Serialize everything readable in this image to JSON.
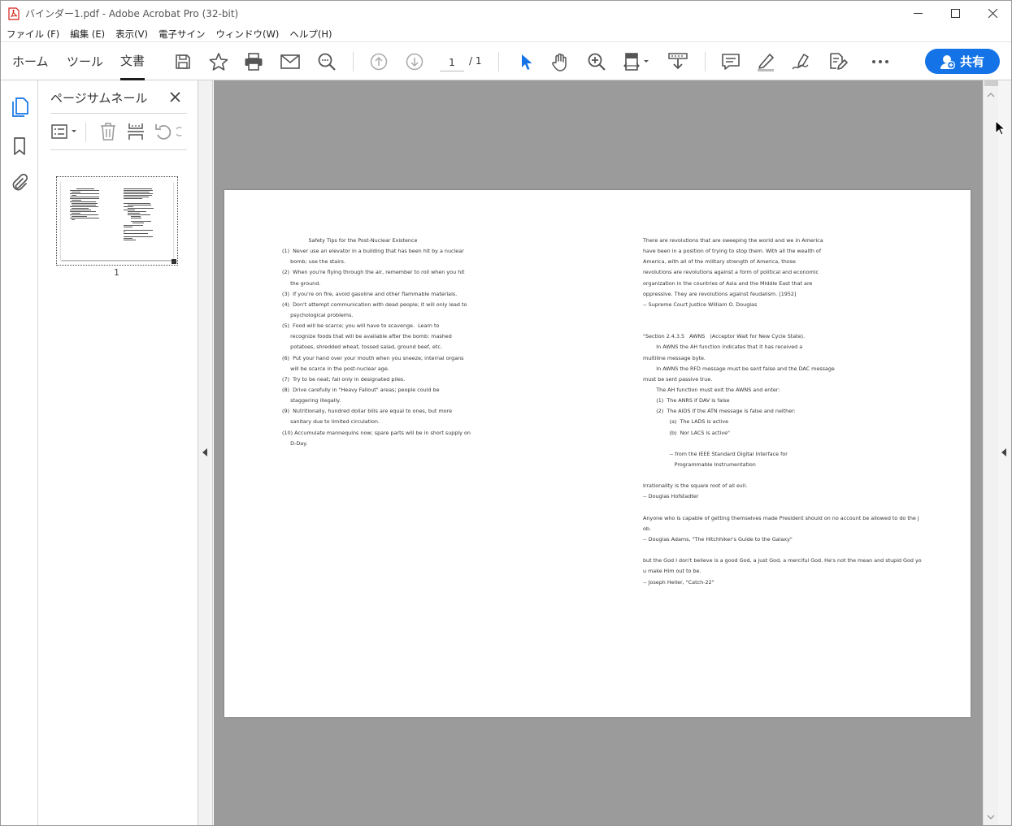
{
  "window": {
    "title": "バインダー1.pdf - Adobe Acrobat Pro (32-bit)"
  },
  "menu": [
    "ファイル (F)",
    "編集 (E)",
    "表示(V)",
    "電子サイン",
    "ウィンドウ(W)",
    "ヘルプ(H)"
  ],
  "tabs": {
    "home": "ホーム",
    "tools": "ツール",
    "document": "文書"
  },
  "toolbar": {
    "page_current": "1",
    "page_total": "/ 1",
    "share_label": "共有"
  },
  "icons": {
    "save": "save-icon",
    "bookmark": "star-icon",
    "print": "print-icon",
    "email": "email-icon",
    "find": "search-icon",
    "prev": "arrow-up-icon",
    "next": "arrow-down-icon",
    "select": "cursor-icon",
    "hand": "hand-icon",
    "zoom": "zoom-in-icon",
    "fit": "fit-page-icon",
    "scroll": "scroll-mode-icon",
    "comment": "comment-icon",
    "highlight": "highlight-icon",
    "sign": "sign-icon",
    "edit": "edit-pdf-icon",
    "more": "more-icon"
  },
  "colors": {
    "accent": "#1473e6",
    "doc_bg": "#9b9b9b"
  },
  "panel": {
    "title": "ページサムネール",
    "thumb_label": "1"
  },
  "page": {
    "left_column": [
      "                Safety Tips for the Post-Nuclear Existence",
      "(1)  Never use an elevator in a building that has been hit by a nuclear",
      "     bomb; use the stairs.",
      "(2)  When you're flying through the air, remember to roll when you hit",
      "     the ground.",
      "(3)  If you're on fire, avoid gasoline and other flammable materials.",
      "(4)  Don't attempt communication with dead people; it will only lead to",
      "     psychological problems.",
      "(5)  Food will be scarce; you will have to scavenge.  Learn to",
      "     recognize foods that will be available after the bomb: mashed",
      "     potatoes, shredded wheat, tossed salad, ground beef, etc.",
      "(6)  Put your hand over your mouth when you sneeze; internal organs",
      "     will be scarce in the post-nuclear age.",
      "(7)  Try to be neat; fall only in designated piles.",
      "(8)  Drive carefully in \"Heavy Fallout\" areas; people could be",
      "     staggering illegally.",
      "(9)  Nutritionally, hundred dollar bills are equal to ones, but more",
      "     sanitary due to limited circulation.",
      "(10) Accumulate mannequins now; spare parts will be in short supply on",
      "     D-Day."
    ],
    "right_column": [
      "There are revolutions that are sweeping the world and we in America",
      "have been in a position of trying to stop them. With all the wealth of",
      "America, with all of the military strength of America, those",
      "revolutions are revolutions against a form of political and economic",
      "organization in the countries of Asia and the Middle East that are",
      "oppressive. They are revolutions against feudalism. [1952]",
      "-- Supreme Court Justice William O. Douglas",
      "",
      "",
      "\"Section 2.4.3.5   AWNS   (Acceptor Wait for New Cycle State).",
      "        In AWNS the AH function indicates that it has received a",
      "multiline message byte.",
      "        In AWNS the RFD message must be sent false and the DAC message",
      "must be sent passive true.",
      "        The AH function must exit the AWNS and enter:",
      "        (1)  The ANRS if DAV is false",
      "        (2)  The AIDS if the ATN message is false and neither:",
      "                (a)  The LADS is active",
      "                (b)  Nor LACS is active\"",
      "",
      "                -- from the IEEE Standard Digital Interface for",
      "                   Programmable Instrumentation",
      "",
      "Irrationality is the square root of all evil.",
      "-- Douglas Hofstadter",
      "",
      "Anyone who is capable of getting themselves made President should on no account be allowed to do the j",
      "ob.",
      "-- Douglas Adams, \"The Hitchhiker's Guide to the Galaxy\"",
      "",
      "but the God I don't believe is a good God, a just God, a merciful God. He's not the mean and stupid God yo",
      "u make Him out to be.",
      "-- Joseph Heller, \"Catch-22\""
    ]
  }
}
